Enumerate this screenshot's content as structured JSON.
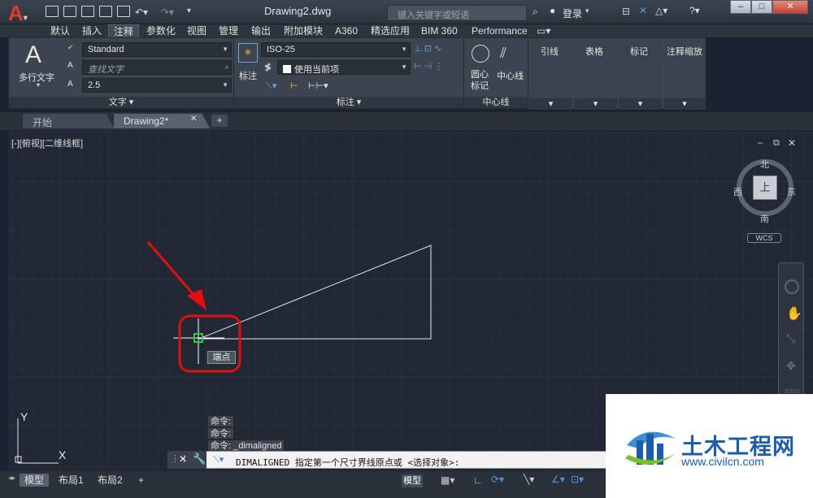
{
  "app_logo": "A",
  "doc_title": "Drawing2.dwg",
  "search": {
    "placeholder": "键入关键字或短语"
  },
  "login_label": "登录",
  "ribbon_tabs": [
    "默认",
    "插入",
    "注释",
    "参数化",
    "视图",
    "管理",
    "输出",
    "附加模块",
    "A360",
    "精选应用",
    "BIM 360",
    "Performance"
  ],
  "active_tab": "注释",
  "text_panel": {
    "big_label": "多行文字",
    "style_combo": "Standard",
    "find_placeholder": "查找文字",
    "height_combo": "2.5",
    "title": "文字"
  },
  "dim_panel": {
    "big_label": "标注",
    "style_combo": "ISO-25",
    "layer_combo": "使用当前项",
    "title": "标注"
  },
  "centerline_panel": {
    "center_mark": "圆心\n标记",
    "centerline": "中心线",
    "title": "中心线"
  },
  "collapsed_panels": [
    "引线",
    "表格",
    "标记",
    "注释缩放"
  ],
  "doc_tabs": [
    "开始",
    "Drawing2*"
  ],
  "view_label": "[-][俯视][二维线框]",
  "viewcube": {
    "north": "北",
    "south": "南",
    "east": "东",
    "west": "西",
    "top": "上",
    "wcs": "WCS"
  },
  "tooltip": "端点",
  "command_history": [
    "命令:",
    "命令:",
    "命令: _dimaligned"
  ],
  "command_line": "DIMALIGNED 指定第一个尺寸界线原点或 <选择对象>:",
  "layout_tabs": [
    "模型",
    "布局1",
    "布局2"
  ],
  "status_model": "模型",
  "ucs": {
    "x": "X",
    "y": "Y"
  },
  "watermark": {
    "title": "土木工程网",
    "url": "www.civilcn.com"
  },
  "colors": {
    "accent": "#e23b2e",
    "highlight": "#2ecc40",
    "arrow": "#e01010",
    "watermark_blue": "#1d5ca8"
  }
}
